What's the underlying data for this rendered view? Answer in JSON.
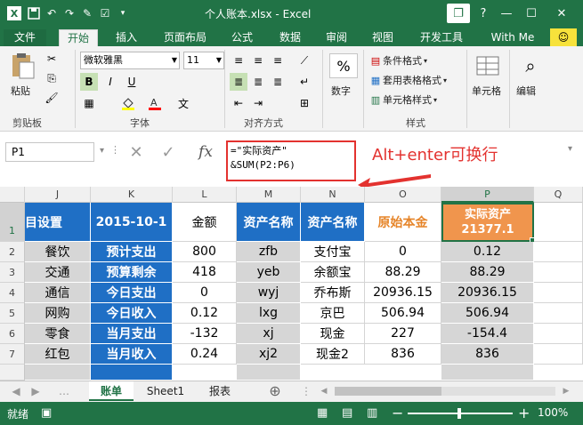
{
  "titlebar": {
    "title": "个人账本.xlsx - Excel",
    "help": "?",
    "restore": "❐",
    "minimize": "—",
    "maximize": "☐",
    "close": "✕"
  },
  "tabs": [
    "文件",
    "开始",
    "插入",
    "页面布局",
    "公式",
    "数据",
    "审阅",
    "视图",
    "开发工具",
    "With Me"
  ],
  "ribbon": {
    "paste_label": "粘贴",
    "clipboard_label": "剪贴板",
    "font_name": "微软雅黑",
    "font_size": "11",
    "bold": "B",
    "italic": "I",
    "underline": "U",
    "font_label": "字体",
    "align_label": "对齐方式",
    "number_icon": "%",
    "number_label": "数字",
    "cond_format": "条件格式",
    "table_format": "套用表格格式",
    "cell_style": "单元格样式",
    "style_label": "样式",
    "cells_label": "单元格",
    "edit_label": "编辑"
  },
  "formula_bar": {
    "name_box": "P1",
    "fx": "fx",
    "formula_line1": "=\"实际资产\"",
    "formula_line2": "&SUM(P2:P6)",
    "annotation": "Alt+enter可换行"
  },
  "columns": [
    "J",
    "K",
    "L",
    "M",
    "N",
    "O",
    "P",
    "Q"
  ],
  "rows": [
    "1",
    "2",
    "3",
    "4",
    "5",
    "6",
    "7"
  ],
  "sheet": {
    "header": {
      "j": "目设置",
      "k": "2015-10-1",
      "l": "金额",
      "m": "资产名称",
      "n": "资产名称",
      "o": "原始本金",
      "p_line1": "实际资产",
      "p_line2": "21377.1"
    },
    "data": [
      [
        "餐饮",
        "预计支出",
        "800",
        "zfb",
        "支付宝",
        "0",
        "0.12"
      ],
      [
        "交通",
        "预算剩余",
        "418",
        "yeb",
        "余额宝",
        "88.29",
        "88.29"
      ],
      [
        "通信",
        "今日支出",
        "0",
        "wyj",
        "乔布斯",
        "20936.15",
        "20936.15"
      ],
      [
        "网购",
        "今日收入",
        "0.12",
        "lxg",
        "京巴",
        "506.94",
        "506.94"
      ],
      [
        "零食",
        "当月支出",
        "-132",
        "xj",
        "现金",
        "227",
        "-154.4"
      ],
      [
        "红包",
        "当月收入",
        "0.24",
        "xj2",
        "现金2",
        "836",
        "836"
      ]
    ]
  },
  "sheet_tabs": [
    "账单",
    "Sheet1",
    "报表"
  ],
  "statusbar": {
    "ready": "就绪",
    "zoom": "100%",
    "minus": "−",
    "plus": "+"
  },
  "colors": {
    "excel_green": "#217346",
    "header_blue": "#1f6fc5",
    "cell_grey": "#d6d6d6",
    "orange": "#e6852a",
    "selected_fill": "#f0954d",
    "annotation_red": "#e3322f"
  }
}
